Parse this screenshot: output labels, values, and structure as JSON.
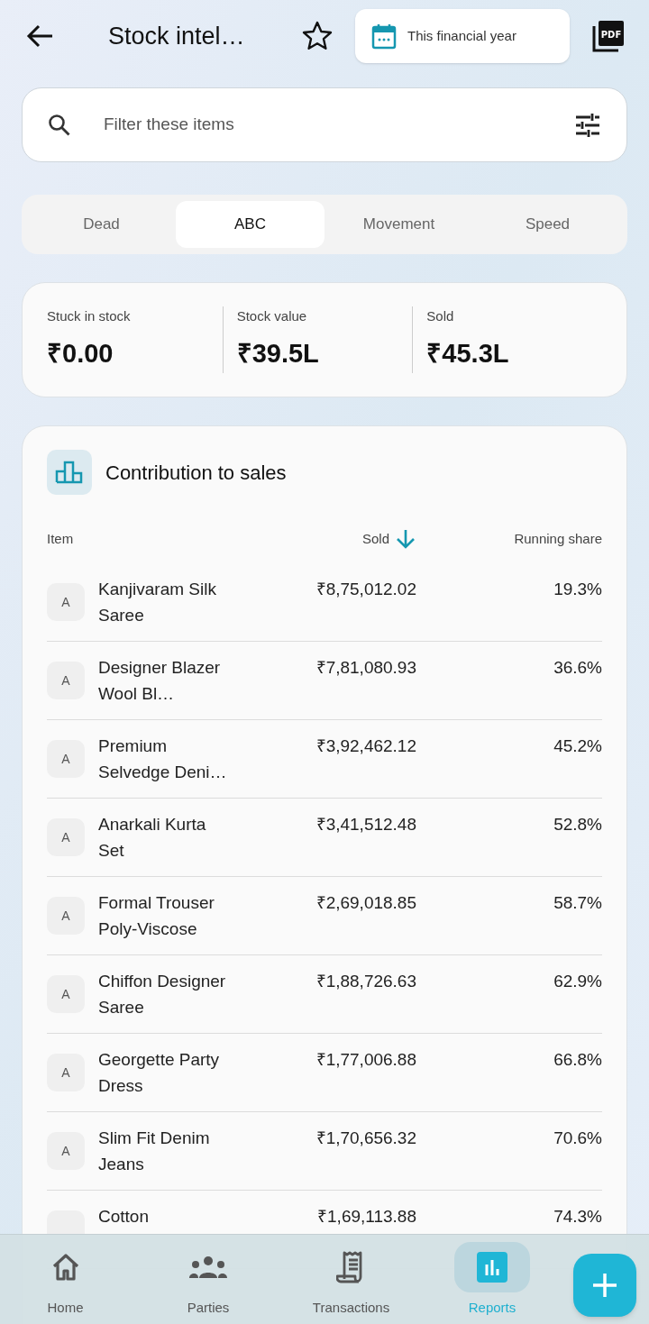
{
  "header": {
    "title": "Stock intel…",
    "starred": false,
    "period": "This financial year",
    "pdf_label": "PDF"
  },
  "search": {
    "placeholder": "Filter these items"
  },
  "tabs": [
    {
      "label": "Dead",
      "selected": false
    },
    {
      "label": "ABC",
      "selected": true
    },
    {
      "label": "Movement",
      "selected": false
    },
    {
      "label": "Speed",
      "selected": false
    }
  ],
  "summary": [
    {
      "label": "Stuck in stock",
      "value": "₹0.00"
    },
    {
      "label": "Stock value",
      "value": "₹39.5L"
    },
    {
      "label": "Sold",
      "value": "₹45.3L"
    }
  ],
  "contribution": {
    "title": "Contribution to sales",
    "columns": [
      {
        "label": "Item",
        "sorted": false
      },
      {
        "label": "Sold",
        "sorted": true
      },
      {
        "label": "Running share",
        "sorted": false
      }
    ],
    "rows": [
      {
        "class": "A",
        "item": "Kanjivaram Silk Saree",
        "sold": "₹8,75,012.02",
        "share": "19.3%"
      },
      {
        "class": "A",
        "item": "Designer Blazer Wool Bl…",
        "sold": "₹7,81,080.93",
        "share": "36.6%"
      },
      {
        "class": "A",
        "item": "Premium Selvedge Deni…",
        "sold": "₹3,92,462.12",
        "share": "45.2%"
      },
      {
        "class": "A",
        "item": "Anarkali Kurta Set",
        "sold": "₹3,41,512.48",
        "share": "52.8%"
      },
      {
        "class": "A",
        "item": "Formal Trouser Poly-Viscose",
        "sold": "₹2,69,018.85",
        "share": "58.7%"
      },
      {
        "class": "A",
        "item": "Chiffon Designer Saree",
        "sold": "₹1,88,726.63",
        "share": "62.9%"
      },
      {
        "class": "A",
        "item": "Georgette Party Dress",
        "sold": "₹1,77,006.88",
        "share": "66.8%"
      },
      {
        "class": "A",
        "item": "Slim Fit Denim Jeans",
        "sold": "₹1,70,656.32",
        "share": "70.6%"
      },
      {
        "item": "Cotton",
        "sold": "₹1,69,113.88",
        "share": "74.3%"
      }
    ]
  },
  "nav": [
    {
      "label": "Home",
      "kind": "home",
      "selected": false
    },
    {
      "label": "Parties",
      "kind": "parties",
      "selected": false
    },
    {
      "label": "Transactions",
      "kind": "transactions",
      "selected": false
    },
    {
      "label": "Reports",
      "kind": "reports",
      "selected": true
    }
  ]
}
